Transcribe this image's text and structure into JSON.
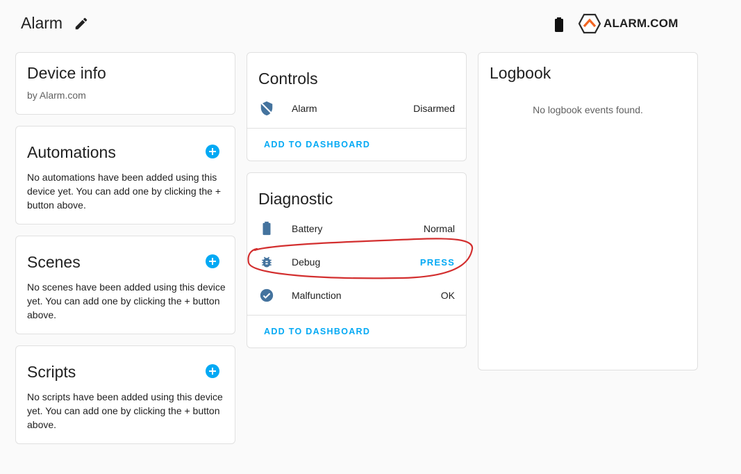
{
  "header": {
    "title": "Alarm",
    "edit_icon": "pencil-icon",
    "battery_icon": "battery-icon",
    "brand": {
      "text": "ALARM.COM",
      "accent": "#f26522"
    }
  },
  "device_info": {
    "title": "Device info",
    "manufacturer": "by Alarm.com"
  },
  "automations": {
    "title": "Automations",
    "text": "No automations have been added using this device yet. You can add one by clicking the + button above."
  },
  "scenes": {
    "title": "Scenes",
    "text": "No scenes have been added using this device yet. You can add one by clicking the + button above."
  },
  "scripts": {
    "title": "Scripts",
    "text": "No scripts have been added using this device yet. You can add one by clicking the + button above."
  },
  "controls": {
    "title": "Controls",
    "rows": [
      {
        "icon": "shield-off-icon",
        "label": "Alarm",
        "value": "Disarmed"
      }
    ],
    "action": "ADD TO DASHBOARD"
  },
  "diagnostic": {
    "title": "Diagnostic",
    "rows": [
      {
        "icon": "battery-icon",
        "label": "Battery",
        "value": "Normal"
      },
      {
        "icon": "bug-icon",
        "label": "Debug",
        "value": "PRESS"
      },
      {
        "icon": "check-circle-icon",
        "label": "Malfunction",
        "value": "OK"
      }
    ],
    "action": "ADD TO DASHBOARD"
  },
  "logbook": {
    "title": "Logbook",
    "empty": "No logbook events found."
  },
  "colors": {
    "accent": "#03a9f4",
    "icon": "#44739e",
    "annotation": "#d32f2f"
  }
}
